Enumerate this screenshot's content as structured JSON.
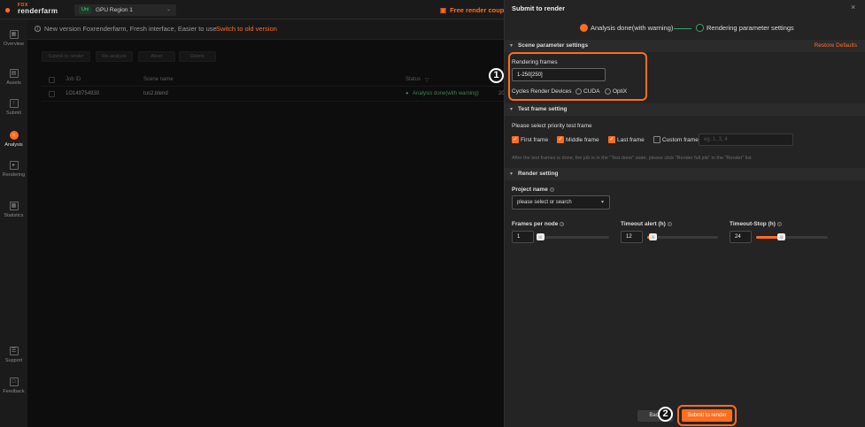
{
  "app": {
    "brand_top": "FOX",
    "brand_name": "renderfarm"
  },
  "region": {
    "tag": "Uni",
    "name": "GPU Region 1"
  },
  "promo": {
    "text": "Free render coupons"
  },
  "nav": [
    {
      "label": "Overview"
    },
    {
      "label": "Assets"
    },
    {
      "label": "Submit"
    },
    {
      "label": "Analysis"
    },
    {
      "label": "Rendering"
    },
    {
      "label": "Statistics"
    },
    {
      "label": "Support"
    },
    {
      "label": "Feedback"
    }
  ],
  "notice": {
    "text": "New version Foxrenderfarm, Fresh interface, Easier to use",
    "link": "Switch to old version"
  },
  "toolbar": {
    "submit": "Submit to render",
    "reanalyze": "Re-analyze",
    "abort": "Abort",
    "delete": "Delete"
  },
  "table": {
    "headers": {
      "job_id": "Job ID",
      "scene_name": "Scene name",
      "status": "Status"
    },
    "rows": [
      {
        "job_id": "1O149754930",
        "scene_name": "tus2.blend",
        "status": "Analysis done(with warning)",
        "extra": "20"
      }
    ]
  },
  "drawer": {
    "title": "Submit to render",
    "steps": [
      "Analysis done(with warning)",
      "Rendering parameter settings"
    ],
    "scene_section": {
      "title": "Scene parameter settings",
      "restore": "Restore Defaults",
      "frames_label": "Rendering frames",
      "frames_value": "1-250[250]",
      "devices_label": "Cycles Render Devices",
      "device_options": [
        "CUDA",
        "OptiX"
      ]
    },
    "test_section": {
      "title": "Test frame setting",
      "prompt": "Please select priority test frame",
      "options": [
        {
          "label": "First frame",
          "checked": true
        },
        {
          "label": "Middle frame",
          "checked": true
        },
        {
          "label": "Last frame",
          "checked": true
        },
        {
          "label": "Custom frame",
          "checked": false
        }
      ],
      "custom_placeholder": "eg. 1, 3, 4",
      "hint": "After the test frames is done, the job is in the \"Test done\" state, please click \"Render full job\" in the \"Render\" list"
    },
    "render_section": {
      "title": "Render setting",
      "project_label": "Project name",
      "project_placeholder": "please select or search",
      "frames_per_node": {
        "label": "Frames per node",
        "value": "1",
        "fill_pct": 2
      },
      "timeout_alert": {
        "label": "Timeout alert (h)",
        "value": "12",
        "fill_pct": 8
      },
      "timeout_stop": {
        "label": "Timeout-Stop (h)",
        "value": "24",
        "fill_pct": 35
      }
    },
    "footer": {
      "back": "Back",
      "submit": "Submit to render"
    }
  },
  "annotations": {
    "badge1": "1",
    "badge2": "2"
  },
  "colors": {
    "accent": "#ff6d1f",
    "success": "#5fc184",
    "panel": "#242424",
    "background": "#141414"
  }
}
